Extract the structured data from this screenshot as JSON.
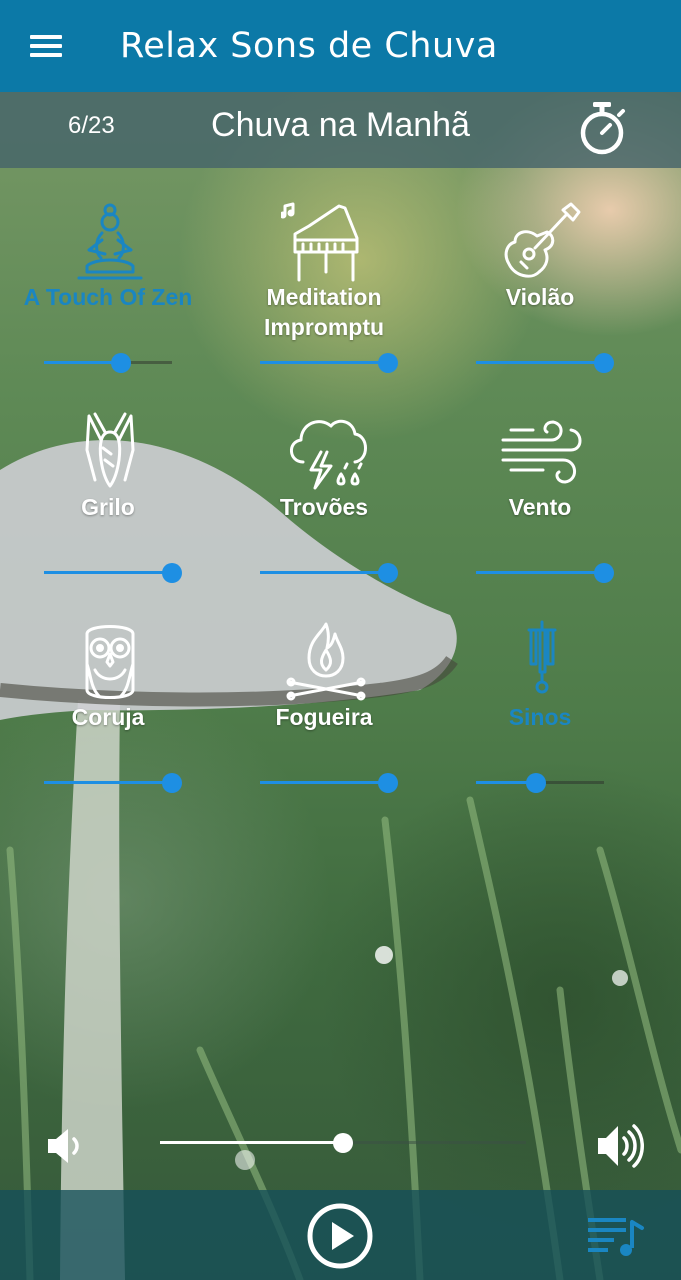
{
  "header": {
    "title": "Relax Sons de Chuva",
    "menu_icon": "hamburger-menu-icon"
  },
  "track": {
    "counter": "6/23",
    "name": "Chuva na Manhã",
    "timer_icon": "stopwatch-icon"
  },
  "colors": {
    "app_bar": "#0c79a7",
    "accent": "#1e8fe3",
    "active_label": "#1a86c2"
  },
  "sounds": [
    {
      "label": "A Touch Of Zen",
      "icon": "meditation-icon",
      "active": true,
      "volume": 0.6
    },
    {
      "label": "Meditation Impromptu",
      "icon": "piano-icon",
      "active": false,
      "volume": 1.0
    },
    {
      "label": "Violão",
      "icon": "guitar-icon",
      "active": false,
      "volume": 1.0
    },
    {
      "label": "Grilo",
      "icon": "cricket-icon",
      "active": false,
      "volume": 1.0
    },
    {
      "label": "Trovões",
      "icon": "thunderstorm-icon",
      "active": false,
      "volume": 1.0
    },
    {
      "label": "Vento",
      "icon": "wind-icon",
      "active": false,
      "volume": 1.0
    },
    {
      "label": "Coruja",
      "icon": "owl-icon",
      "active": false,
      "volume": 1.0
    },
    {
      "label": "Fogueira",
      "icon": "campfire-icon",
      "active": false,
      "volume": 1.0
    },
    {
      "label": "Sinos",
      "icon": "wind-chime-icon",
      "active": true,
      "volume": 0.47
    }
  ],
  "master_volume": {
    "level": 0.5,
    "low_icon": "volume-low-icon",
    "high_icon": "volume-high-icon"
  },
  "controls": {
    "play_icon": "play-icon",
    "playlist_icon": "playlist-icon"
  }
}
